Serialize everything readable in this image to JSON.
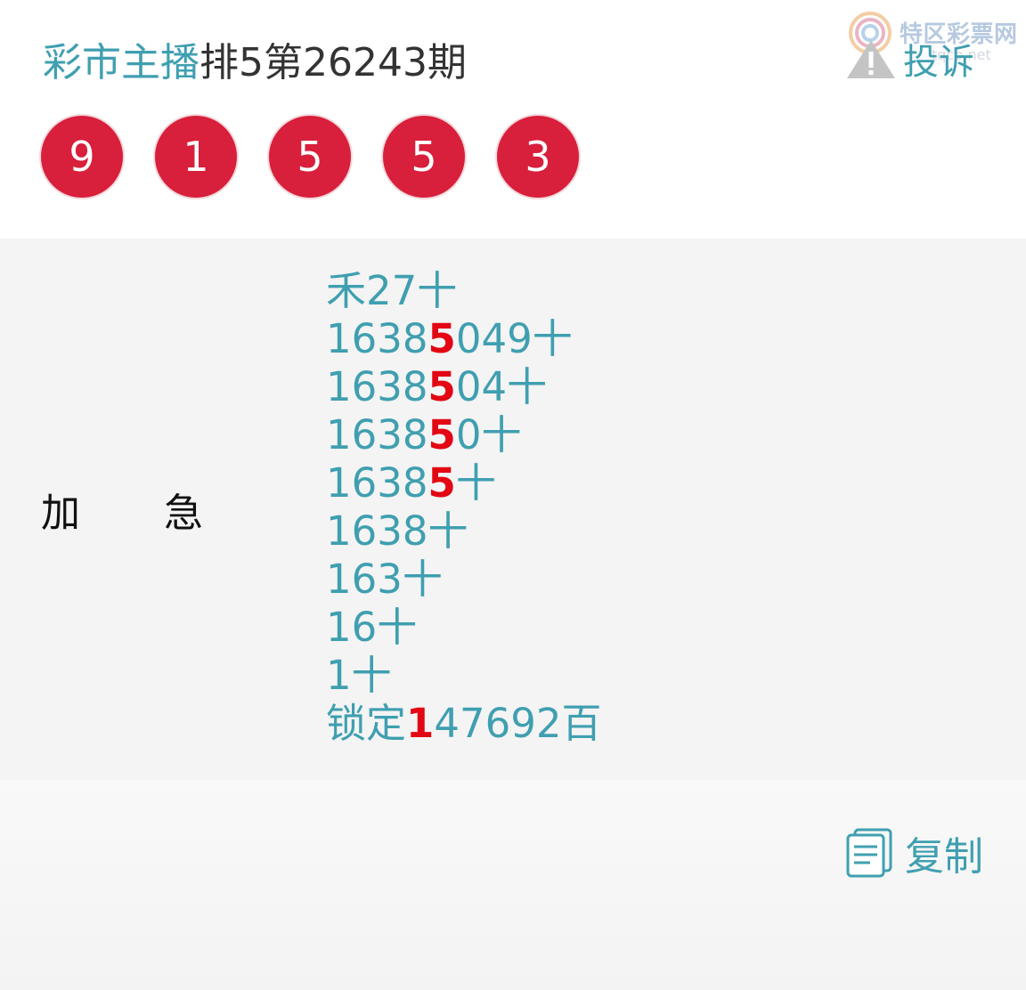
{
  "header": {
    "brand": "彩市主播",
    "title": "排5第26243期"
  },
  "watermark": {
    "text": "特区彩票网",
    "sub": "tqcp.net"
  },
  "report": {
    "label": "投诉",
    "icon": "warning-icon"
  },
  "draw": {
    "balls": [
      "9",
      "1",
      "5",
      "5",
      "3"
    ],
    "ball_color": "#d81f3b"
  },
  "content": {
    "label_left": "加",
    "label_right": "急",
    "lines": [
      {
        "pre": "禾27十",
        "hl": "",
        "post": ""
      },
      {
        "pre": "1638",
        "hl": "5",
        "post": "049十"
      },
      {
        "pre": "1638",
        "hl": "5",
        "post": "04十"
      },
      {
        "pre": "1638",
        "hl": "5",
        "post": "0十"
      },
      {
        "pre": "1638",
        "hl": "5",
        "post": "十"
      },
      {
        "pre": "1638十",
        "hl": "",
        "post": ""
      },
      {
        "pre": "163十",
        "hl": "",
        "post": ""
      },
      {
        "pre": "16十",
        "hl": "",
        "post": ""
      },
      {
        "pre": "1十",
        "hl": "",
        "post": ""
      },
      {
        "pre": "锁定",
        "hl": "1",
        "post": "47692百"
      }
    ],
    "text_color": "#3f9fb0",
    "highlight_color": "#e30613"
  },
  "footer": {
    "copy_label": "复制",
    "copy_icon": "copy-icon"
  }
}
